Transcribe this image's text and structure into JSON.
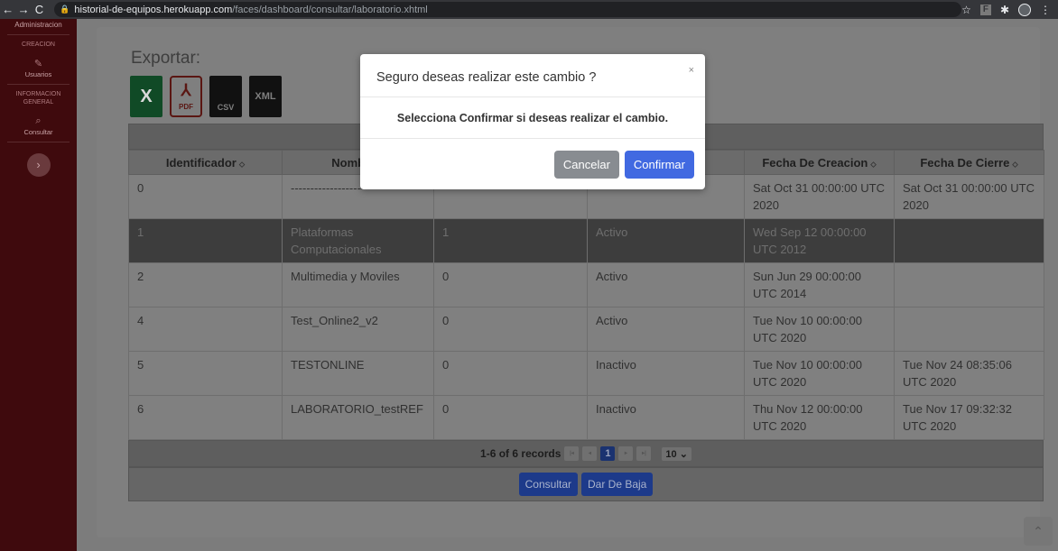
{
  "browser": {
    "url_host": "historial-de-equipos.herokuapp.com",
    "url_path": "/faces/dashboard/consultar/laboratorio.xhtml",
    "ext_label": "F"
  },
  "sidebar": {
    "brand": "Administracion",
    "section1": "CREACION",
    "item_users": "Usuarios",
    "section2": "INFORMACION GENERAL",
    "item_consult": "Consultar",
    "toggle": "›"
  },
  "main": {
    "export_title": "Exportar:",
    "export_icons": [
      "excel-icon",
      "pdf-icon",
      "csv-icon",
      "xml-icon"
    ],
    "xls_label": "X",
    "pdf_label": "PDF",
    "csv_label": "CSV",
    "xml_label": "XML",
    "columns": [
      "Identificador",
      "Nombre",
      "",
      "",
      "Fecha De Creacion",
      "Fecha De Cierre"
    ],
    "sort_glyph": "⬦",
    "rows": [
      {
        "id": "0",
        "nombre": "------------------------",
        "c3": "",
        "estado": "",
        "creacion": "Sat Oct 31 00:00:00 UTC 2020",
        "cierre": "Sat Oct 31 00:00:00 UTC 2020"
      },
      {
        "id": "1",
        "nombre": "Plataformas Computacionales",
        "c3": "1",
        "estado": "Activo",
        "creacion": "Wed Sep 12 00:00:00 UTC 2012",
        "cierre": ""
      },
      {
        "id": "2",
        "nombre": "Multimedia y Moviles",
        "c3": "0",
        "estado": "Activo",
        "creacion": "Sun Jun 29 00:00:00 UTC 2014",
        "cierre": ""
      },
      {
        "id": "4",
        "nombre": "Test_Online2_v2",
        "c3": "0",
        "estado": "Activo",
        "creacion": "Tue Nov 10 00:00:00 UTC 2020",
        "cierre": ""
      },
      {
        "id": "5",
        "nombre": "TESTONLINE",
        "c3": "0",
        "estado": "Inactivo",
        "creacion": "Tue Nov 10 00:00:00 UTC 2020",
        "cierre": "Tue Nov 24 08:35:06 UTC 2020"
      },
      {
        "id": "6",
        "nombre": "LABORATORIO_testREF",
        "c3": "0",
        "estado": "Inactivo",
        "creacion": "Thu Nov 12 00:00:00 UTC 2020",
        "cierre": "Tue Nov 17 09:32:32 UTC 2020"
      }
    ],
    "selected_row": 1,
    "pager": {
      "records": "1-6 of 6 records",
      "current_page": "1",
      "rows_per_page": "10"
    },
    "btn_consultar": "Consultar",
    "btn_dar_de_baja": "Dar De Baja"
  },
  "modal": {
    "title": "Seguro deseas realizar este cambio ?",
    "message": "Selecciona Confirmar si deseas realizar el cambio.",
    "cancel": "Cancelar",
    "confirm": "Confirmar",
    "close": "×"
  },
  "colors": {
    "sidebar": "#3f0a0d",
    "confirm": "#4169e1",
    "cancel": "#888c91"
  }
}
